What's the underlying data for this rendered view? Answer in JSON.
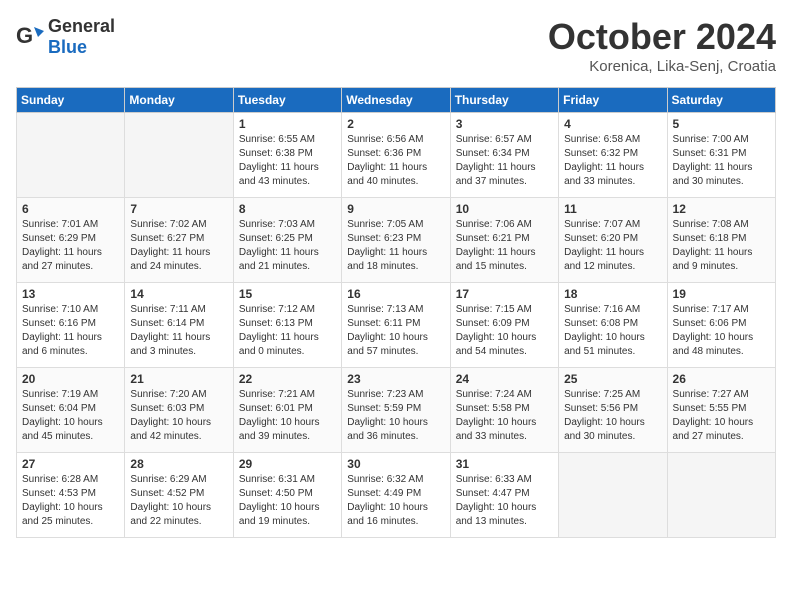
{
  "header": {
    "logo_general": "General",
    "logo_blue": "Blue",
    "title": "October 2024",
    "location": "Korenica, Lika-Senj, Croatia"
  },
  "weekdays": [
    "Sunday",
    "Monday",
    "Tuesday",
    "Wednesday",
    "Thursday",
    "Friday",
    "Saturday"
  ],
  "weeks": [
    [
      {
        "day": "",
        "sunrise": "",
        "sunset": "",
        "daylight": ""
      },
      {
        "day": "",
        "sunrise": "",
        "sunset": "",
        "daylight": ""
      },
      {
        "day": "1",
        "sunrise": "Sunrise: 6:55 AM",
        "sunset": "Sunset: 6:38 PM",
        "daylight": "Daylight: 11 hours and 43 minutes."
      },
      {
        "day": "2",
        "sunrise": "Sunrise: 6:56 AM",
        "sunset": "Sunset: 6:36 PM",
        "daylight": "Daylight: 11 hours and 40 minutes."
      },
      {
        "day": "3",
        "sunrise": "Sunrise: 6:57 AM",
        "sunset": "Sunset: 6:34 PM",
        "daylight": "Daylight: 11 hours and 37 minutes."
      },
      {
        "day": "4",
        "sunrise": "Sunrise: 6:58 AM",
        "sunset": "Sunset: 6:32 PM",
        "daylight": "Daylight: 11 hours and 33 minutes."
      },
      {
        "day": "5",
        "sunrise": "Sunrise: 7:00 AM",
        "sunset": "Sunset: 6:31 PM",
        "daylight": "Daylight: 11 hours and 30 minutes."
      }
    ],
    [
      {
        "day": "6",
        "sunrise": "Sunrise: 7:01 AM",
        "sunset": "Sunset: 6:29 PM",
        "daylight": "Daylight: 11 hours and 27 minutes."
      },
      {
        "day": "7",
        "sunrise": "Sunrise: 7:02 AM",
        "sunset": "Sunset: 6:27 PM",
        "daylight": "Daylight: 11 hours and 24 minutes."
      },
      {
        "day": "8",
        "sunrise": "Sunrise: 7:03 AM",
        "sunset": "Sunset: 6:25 PM",
        "daylight": "Daylight: 11 hours and 21 minutes."
      },
      {
        "day": "9",
        "sunrise": "Sunrise: 7:05 AM",
        "sunset": "Sunset: 6:23 PM",
        "daylight": "Daylight: 11 hours and 18 minutes."
      },
      {
        "day": "10",
        "sunrise": "Sunrise: 7:06 AM",
        "sunset": "Sunset: 6:21 PM",
        "daylight": "Daylight: 11 hours and 15 minutes."
      },
      {
        "day": "11",
        "sunrise": "Sunrise: 7:07 AM",
        "sunset": "Sunset: 6:20 PM",
        "daylight": "Daylight: 11 hours and 12 minutes."
      },
      {
        "day": "12",
        "sunrise": "Sunrise: 7:08 AM",
        "sunset": "Sunset: 6:18 PM",
        "daylight": "Daylight: 11 hours and 9 minutes."
      }
    ],
    [
      {
        "day": "13",
        "sunrise": "Sunrise: 7:10 AM",
        "sunset": "Sunset: 6:16 PM",
        "daylight": "Daylight: 11 hours and 6 minutes."
      },
      {
        "day": "14",
        "sunrise": "Sunrise: 7:11 AM",
        "sunset": "Sunset: 6:14 PM",
        "daylight": "Daylight: 11 hours and 3 minutes."
      },
      {
        "day": "15",
        "sunrise": "Sunrise: 7:12 AM",
        "sunset": "Sunset: 6:13 PM",
        "daylight": "Daylight: 11 hours and 0 minutes."
      },
      {
        "day": "16",
        "sunrise": "Sunrise: 7:13 AM",
        "sunset": "Sunset: 6:11 PM",
        "daylight": "Daylight: 10 hours and 57 minutes."
      },
      {
        "day": "17",
        "sunrise": "Sunrise: 7:15 AM",
        "sunset": "Sunset: 6:09 PM",
        "daylight": "Daylight: 10 hours and 54 minutes."
      },
      {
        "day": "18",
        "sunrise": "Sunrise: 7:16 AM",
        "sunset": "Sunset: 6:08 PM",
        "daylight": "Daylight: 10 hours and 51 minutes."
      },
      {
        "day": "19",
        "sunrise": "Sunrise: 7:17 AM",
        "sunset": "Sunset: 6:06 PM",
        "daylight": "Daylight: 10 hours and 48 minutes."
      }
    ],
    [
      {
        "day": "20",
        "sunrise": "Sunrise: 7:19 AM",
        "sunset": "Sunset: 6:04 PM",
        "daylight": "Daylight: 10 hours and 45 minutes."
      },
      {
        "day": "21",
        "sunrise": "Sunrise: 7:20 AM",
        "sunset": "Sunset: 6:03 PM",
        "daylight": "Daylight: 10 hours and 42 minutes."
      },
      {
        "day": "22",
        "sunrise": "Sunrise: 7:21 AM",
        "sunset": "Sunset: 6:01 PM",
        "daylight": "Daylight: 10 hours and 39 minutes."
      },
      {
        "day": "23",
        "sunrise": "Sunrise: 7:23 AM",
        "sunset": "Sunset: 5:59 PM",
        "daylight": "Daylight: 10 hours and 36 minutes."
      },
      {
        "day": "24",
        "sunrise": "Sunrise: 7:24 AM",
        "sunset": "Sunset: 5:58 PM",
        "daylight": "Daylight: 10 hours and 33 minutes."
      },
      {
        "day": "25",
        "sunrise": "Sunrise: 7:25 AM",
        "sunset": "Sunset: 5:56 PM",
        "daylight": "Daylight: 10 hours and 30 minutes."
      },
      {
        "day": "26",
        "sunrise": "Sunrise: 7:27 AM",
        "sunset": "Sunset: 5:55 PM",
        "daylight": "Daylight: 10 hours and 27 minutes."
      }
    ],
    [
      {
        "day": "27",
        "sunrise": "Sunrise: 6:28 AM",
        "sunset": "Sunset: 4:53 PM",
        "daylight": "Daylight: 10 hours and 25 minutes."
      },
      {
        "day": "28",
        "sunrise": "Sunrise: 6:29 AM",
        "sunset": "Sunset: 4:52 PM",
        "daylight": "Daylight: 10 hours and 22 minutes."
      },
      {
        "day": "29",
        "sunrise": "Sunrise: 6:31 AM",
        "sunset": "Sunset: 4:50 PM",
        "daylight": "Daylight: 10 hours and 19 minutes."
      },
      {
        "day": "30",
        "sunrise": "Sunrise: 6:32 AM",
        "sunset": "Sunset: 4:49 PM",
        "daylight": "Daylight: 10 hours and 16 minutes."
      },
      {
        "day": "31",
        "sunrise": "Sunrise: 6:33 AM",
        "sunset": "Sunset: 4:47 PM",
        "daylight": "Daylight: 10 hours and 13 minutes."
      },
      {
        "day": "",
        "sunrise": "",
        "sunset": "",
        "daylight": ""
      },
      {
        "day": "",
        "sunrise": "",
        "sunset": "",
        "daylight": ""
      }
    ]
  ]
}
